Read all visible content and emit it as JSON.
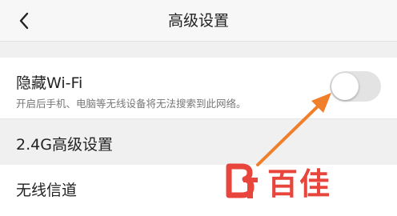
{
  "header": {
    "title": "高级设置",
    "back_icon": "chevron-left-icon"
  },
  "hide_wifi": {
    "label": "隐藏Wi-Fi",
    "description": "开启后手机、电脑等无线设备将无法搜索到此网络。",
    "toggle_state": "off"
  },
  "section": {
    "label": "2.4G高级设置"
  },
  "channel": {
    "label": "无线信道"
  },
  "annotation": {
    "arrow_color": "#f07f2c"
  },
  "watermark": {
    "text": "百佳",
    "logo_icon": "baijia-logo-icon",
    "color": "#e8453c"
  }
}
